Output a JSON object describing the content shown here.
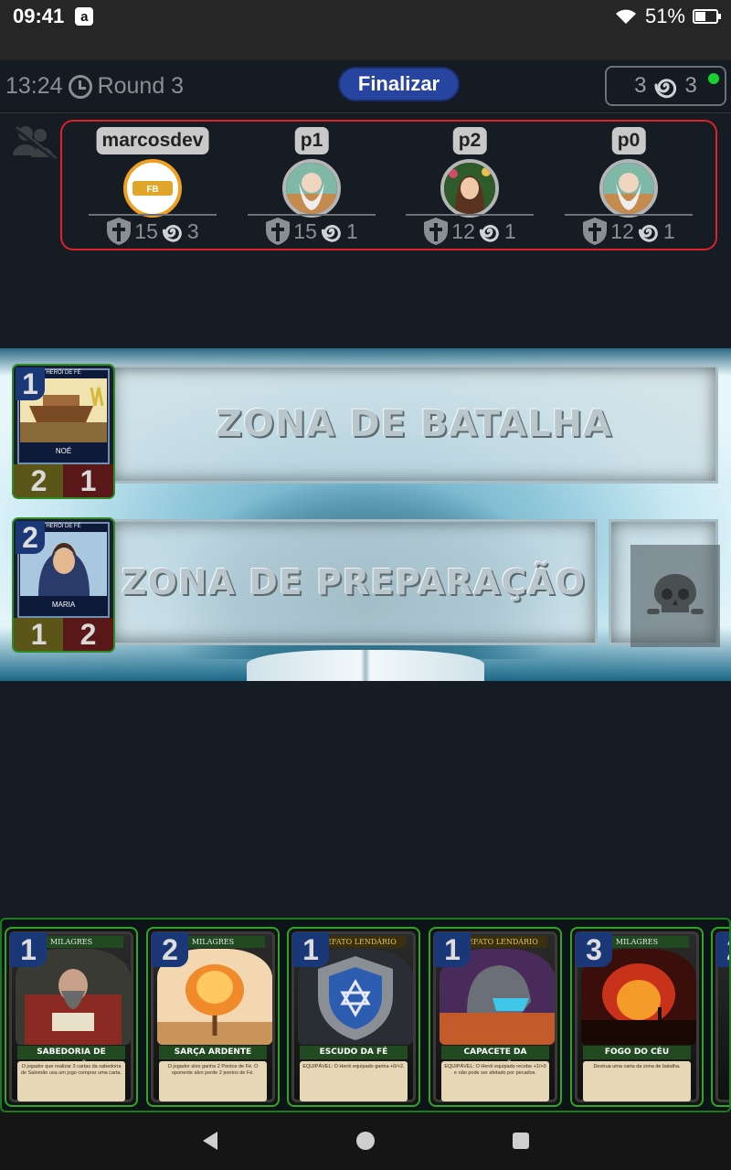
{
  "status_bar": {
    "time": "09:41",
    "app_badge": "a",
    "battery": "51%",
    "battery_level": 0.51
  },
  "top_bar": {
    "timer": "13:24",
    "round": "Round 3",
    "finish_button": "Finalizar",
    "mana_left": "3",
    "mana_right": "3",
    "online_color": "#19d12e"
  },
  "players": [
    {
      "name": "marcosdev",
      "shield": "15",
      "mana": "3",
      "active": true,
      "avatar": "faith-battle-logo"
    },
    {
      "name": "p1",
      "shield": "15",
      "mana": "1",
      "active": false,
      "avatar": "old-sage"
    },
    {
      "name": "p2",
      "shield": "12",
      "mana": "1",
      "active": false,
      "avatar": "woman-with-flowers"
    },
    {
      "name": "p0",
      "shield": "12",
      "mana": "1",
      "active": false,
      "avatar": "old-sage"
    }
  ],
  "board": {
    "battle_zone_label": "ZONA DE BATALHA",
    "prep_zone_label": "ZONA DE PREPARAÇÃO",
    "battle_cards": [
      {
        "cost": "1",
        "type": "HERÓI DE FÉ",
        "name": "NOÉ",
        "attack": "2",
        "defense": "1"
      }
    ],
    "prep_cards": [
      {
        "cost": "2",
        "type": "HERÓI DE FÉ",
        "name": "MARIA",
        "attack": "1",
        "defense": "2"
      }
    ]
  },
  "hand": [
    {
      "cost": "1",
      "type": "MILAGRES",
      "name": "SABEDORIA DE SALOMÃO",
      "text": "O jogador que realizar 3 cartas da sabedoria de Salomão usa um jogo comprar uma carta."
    },
    {
      "cost": "2",
      "type": "MILAGRES",
      "name": "SARÇA ARDENTE",
      "text": "O jogador alvo ganha 2 Pontos de Fé. O oponente alvo perde 2 pontos de Fé."
    },
    {
      "cost": "1",
      "type": "ARTEFATO LENDÁRIO",
      "name": "ESCUDO DA FÉ",
      "text": "EQUIPÁVEL: O Herói equipado ganha +0/+2."
    },
    {
      "cost": "1",
      "type": "ARTEFATO LENDÁRIO",
      "name": "CAPACETE DA SALVAÇÃO",
      "text": "EQUIPÁVEL: O Herói equipado recebe +1/+0 e não pode ser afetado por pecados."
    },
    {
      "cost": "3",
      "type": "MILAGRES",
      "name": "FOGO DO CÉU",
      "text": "Destrua uma carta da zona de batalha."
    },
    {
      "cost": "2",
      "type": "",
      "name": "",
      "text": ""
    }
  ]
}
